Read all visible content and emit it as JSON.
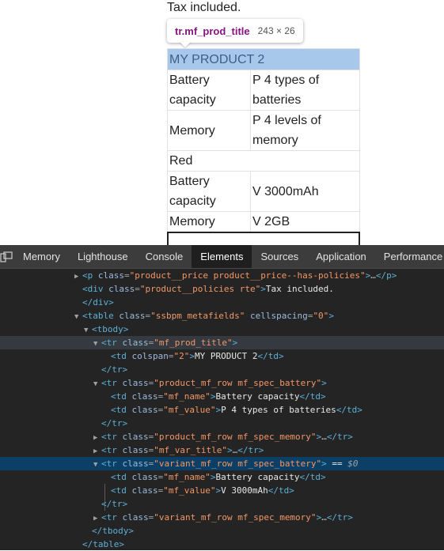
{
  "preview": {
    "tax_line": "Tax included.",
    "tooltip": {
      "selector": "tr.mf_prod_title",
      "size": "243 × 26"
    },
    "table": {
      "title": "MY PRODUCT 2",
      "rows": [
        {
          "name": "Battery\ncapacity",
          "value": "P 4 types of\nbatteries"
        },
        {
          "name": "Memory",
          "value": "P 4 levels of\nmemory"
        }
      ],
      "var_title": "Red",
      "variant_rows": [
        {
          "name": "Battery\ncapacity",
          "value": "V 3000mAh"
        },
        {
          "name": "Memory",
          "value": "V 2GB"
        }
      ]
    }
  },
  "devtools": {
    "tabs": [
      "Memory",
      "Lighthouse",
      "Console",
      "Elements",
      "Sources",
      "Application",
      "Performance"
    ],
    "active_tab": "Elements",
    "lines": [
      {
        "indent": 104,
        "tri": "▶",
        "state": "",
        "parts": [
          [
            "tag",
            "<p "
          ],
          [
            "attr",
            "class"
          ],
          [
            "eq",
            "="
          ],
          [
            "val",
            "\"product__price product__price--has-policies\""
          ],
          [
            "tag",
            ">"
          ],
          [
            "ell",
            "…"
          ],
          [
            "tag",
            "</p>"
          ]
        ]
      },
      {
        "indent": 104,
        "tri": "",
        "state": "",
        "parts": [
          [
            "tag",
            "<div "
          ],
          [
            "attr",
            "class"
          ],
          [
            "eq",
            "="
          ],
          [
            "val",
            "\"product__policies rte\""
          ],
          [
            "tag",
            ">"
          ],
          [
            "txt",
            "Tax included."
          ]
        ]
      },
      {
        "indent": 104,
        "tri": "",
        "state": "",
        "parts": [
          [
            "tag",
            "</div>"
          ]
        ]
      },
      {
        "indent": 104,
        "tri": "▼",
        "state": "",
        "parts": [
          [
            "tag",
            "<table "
          ],
          [
            "attr",
            "class"
          ],
          [
            "eq",
            "="
          ],
          [
            "val",
            "\"ssbpm_metafields\""
          ],
          [
            "txt",
            " "
          ],
          [
            "attr",
            "cellspacing"
          ],
          [
            "eq",
            "="
          ],
          [
            "val",
            "\"0\""
          ],
          [
            "tag",
            ">"
          ]
        ]
      },
      {
        "indent": 116,
        "tri": "▼",
        "state": "",
        "parts": [
          [
            "tag",
            "<tbody>"
          ]
        ]
      },
      {
        "indent": 128,
        "tri": "▼",
        "state": "hover",
        "parts": [
          [
            "tag",
            "<tr "
          ],
          [
            "attr",
            "class"
          ],
          [
            "eq",
            "="
          ],
          [
            "val",
            "\"mf_prod_title\""
          ],
          [
            "tag",
            ">"
          ]
        ]
      },
      {
        "indent": 140,
        "tri": "",
        "state": "",
        "parts": [
          [
            "tag",
            "<td "
          ],
          [
            "attr",
            "colspan"
          ],
          [
            "eq",
            "="
          ],
          [
            "val",
            "\"2\""
          ],
          [
            "tag",
            ">"
          ],
          [
            "txt",
            "MY PRODUCT 2"
          ],
          [
            "tag",
            "</td>"
          ]
        ]
      },
      {
        "indent": 128,
        "tri": "",
        "state": "",
        "parts": [
          [
            "tag",
            "</tr>"
          ]
        ]
      },
      {
        "indent": 128,
        "tri": "▼",
        "state": "",
        "parts": [
          [
            "tag",
            "<tr "
          ],
          [
            "attr",
            "class"
          ],
          [
            "eq",
            "="
          ],
          [
            "val",
            "\"product_mf_row mf_spec_battery\""
          ],
          [
            "tag",
            ">"
          ]
        ]
      },
      {
        "indent": 140,
        "tri": "",
        "state": "",
        "parts": [
          [
            "tag",
            "<td "
          ],
          [
            "attr",
            "class"
          ],
          [
            "eq",
            "="
          ],
          [
            "val",
            "\"mf_name\""
          ],
          [
            "tag",
            ">"
          ],
          [
            "txt",
            "Battery capacity"
          ],
          [
            "tag",
            "</td>"
          ]
        ]
      },
      {
        "indent": 140,
        "tri": "",
        "state": "",
        "parts": [
          [
            "tag",
            "<td "
          ],
          [
            "attr",
            "class"
          ],
          [
            "eq",
            "="
          ],
          [
            "val",
            "\"mf_value\""
          ],
          [
            "tag",
            ">"
          ],
          [
            "txt",
            "P 4 types of batteries"
          ],
          [
            "tag",
            "</td>"
          ]
        ]
      },
      {
        "indent": 128,
        "tri": "",
        "state": "",
        "parts": [
          [
            "tag",
            "</tr>"
          ]
        ]
      },
      {
        "indent": 128,
        "tri": "▶",
        "state": "",
        "parts": [
          [
            "tag",
            "<tr "
          ],
          [
            "attr",
            "class"
          ],
          [
            "eq",
            "="
          ],
          [
            "val",
            "\"product_mf_row mf_spec_memory\""
          ],
          [
            "tag",
            ">"
          ],
          [
            "ell",
            "…"
          ],
          [
            "tag",
            "</tr>"
          ]
        ]
      },
      {
        "indent": 128,
        "tri": "▶",
        "state": "",
        "parts": [
          [
            "tag",
            "<tr "
          ],
          [
            "attr",
            "class"
          ],
          [
            "eq",
            "="
          ],
          [
            "val",
            "\"mf_var_title\""
          ],
          [
            "tag",
            ">"
          ],
          [
            "ell",
            "…"
          ],
          [
            "tag",
            "</tr>"
          ]
        ]
      },
      {
        "indent": 128,
        "tri": "▼",
        "state": "sel",
        "parts": [
          [
            "tag",
            "<tr "
          ],
          [
            "attr",
            "class"
          ],
          [
            "eq",
            "="
          ],
          [
            "val",
            "\"variant_mf_row mf_spec_battery\""
          ],
          [
            "tag",
            ">"
          ],
          [
            "txt",
            " == "
          ],
          [
            "dollar",
            "$0"
          ]
        ]
      },
      {
        "indent": 140,
        "tri": "",
        "state": "",
        "parts": [
          [
            "tag",
            "<td "
          ],
          [
            "attr",
            "class"
          ],
          [
            "eq",
            "="
          ],
          [
            "val",
            "\"mf_name\""
          ],
          [
            "tag",
            ">"
          ],
          [
            "txt",
            "Battery capacity"
          ],
          [
            "tag",
            "</td>"
          ]
        ]
      },
      {
        "indent": 140,
        "tri": "",
        "state": "",
        "parts": [
          [
            "tag",
            "<td "
          ],
          [
            "attr",
            "class"
          ],
          [
            "eq",
            "="
          ],
          [
            "val",
            "\"mf_value\""
          ],
          [
            "tag",
            ">"
          ],
          [
            "txt",
            "V 3000mAh"
          ],
          [
            "tag",
            "</td>"
          ]
        ]
      },
      {
        "indent": 128,
        "tri": "",
        "state": "",
        "parts": [
          [
            "tag",
            "</tr>"
          ]
        ]
      },
      {
        "indent": 128,
        "tri": "▶",
        "state": "",
        "parts": [
          [
            "tag",
            "<tr "
          ],
          [
            "attr",
            "class"
          ],
          [
            "eq",
            "="
          ],
          [
            "val",
            "\"variant_mf_row mf_spec_memory\""
          ],
          [
            "tag",
            ">"
          ],
          [
            "ell",
            "…"
          ],
          [
            "tag",
            "</tr>"
          ]
        ]
      },
      {
        "indent": 116,
        "tri": "",
        "state": "",
        "parts": [
          [
            "tag",
            "</tbody>"
          ]
        ]
      },
      {
        "indent": 104,
        "tri": "",
        "state": "",
        "parts": [
          [
            "tag",
            "</table>"
          ]
        ]
      }
    ]
  }
}
